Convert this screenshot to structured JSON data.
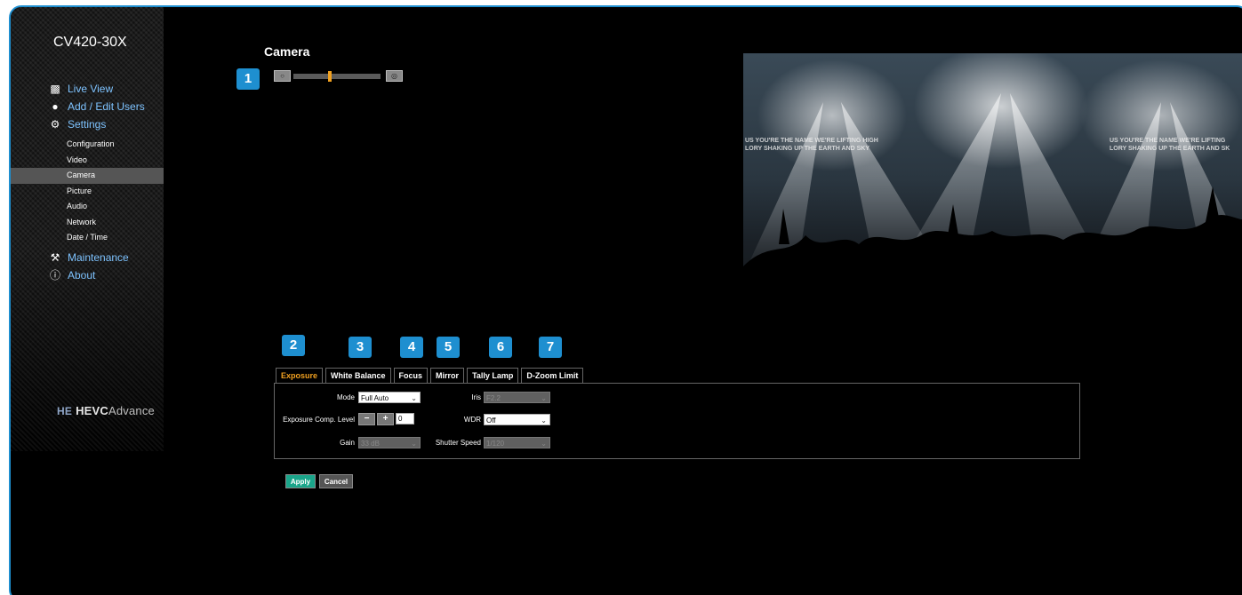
{
  "sidebar": {
    "model": "CV420-30X",
    "nav": {
      "live_view": "Live View",
      "add_edit_users": "Add / Edit Users",
      "settings": "Settings",
      "maintenance": "Maintenance",
      "about": "About"
    },
    "settings_items": [
      "Configuration",
      "Video",
      "Camera",
      "Picture",
      "Audio",
      "Network",
      "Date / Time"
    ],
    "active_item": "Camera",
    "brand": {
      "mark": "HE",
      "name": "HEVC",
      "suffix": "Advance"
    }
  },
  "page": {
    "title": "Camera"
  },
  "callouts": [
    "1",
    "2",
    "3",
    "4",
    "5",
    "6",
    "7"
  ],
  "zoom": {
    "level": 0.42,
    "thumb_color": "#f0a020"
  },
  "preview": {
    "overlay_left": [
      "US YOU'RE THE NAME WE'RE LIFTING HIGH",
      "LORY SHAKING UP THE EARTH AND SKY"
    ],
    "overlay_right": [
      "US YOU'RE THE NAME WE'RE LIFTING",
      "LORY SHAKING UP THE EARTH AND SK"
    ]
  },
  "tabs": [
    "Exposure",
    "White Balance",
    "Focus",
    "Mirror",
    "Tally Lamp",
    "D-Zoom Limit"
  ],
  "active_tab": "Exposure",
  "exposure": {
    "mode_label": "Mode",
    "mode_value": "Full Auto",
    "comp_label": "Exposure Comp. Level",
    "comp_minus": "−",
    "comp_plus": "+",
    "comp_value": "0",
    "gain_label": "Gain",
    "gain_value": "33 dB",
    "iris_label": "Iris",
    "iris_value": "F2.2",
    "wdr_label": "WDR",
    "wdr_value": "Off",
    "shutter_label": "Shutter Speed",
    "shutter_value": "1/120"
  },
  "buttons": {
    "apply": "Apply",
    "cancel": "Cancel"
  },
  "colors": {
    "frame_border": "#1e8fd0",
    "callout": "#1e8fd0",
    "active_tab": "#f0a020",
    "apply": "#1aa58a",
    "nav_link": "#7ec3ff"
  }
}
